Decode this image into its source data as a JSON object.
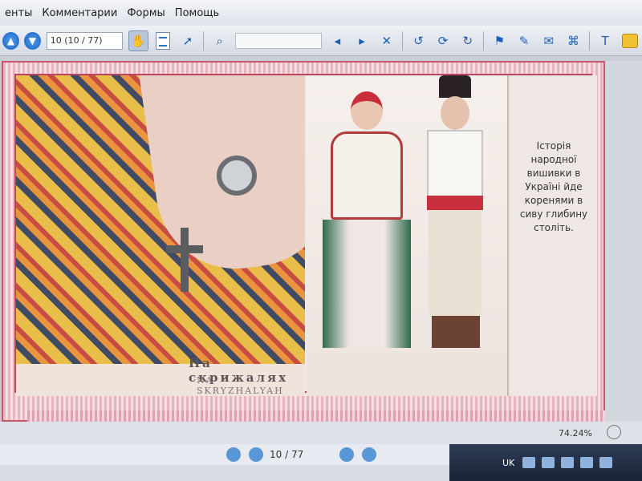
{
  "menubar": {
    "items": [
      "енты",
      "Комментарии",
      "Формы",
      "Помощь"
    ]
  },
  "toolbar": {
    "page_field": "10 (10 / 77)",
    "search_placeholder": ""
  },
  "slide": {
    "caption_title": "На скрижалях",
    "caption_sub": "NA-SKRYZHALYAH",
    "text": "Історія народної вишивки в Україні йде коренями в сиву глибину століть."
  },
  "status": {
    "zoom": "74.24%"
  },
  "navigation": {
    "page_indicator": "10 / 77"
  },
  "taskbar": {
    "language": "UK"
  },
  "colors": {
    "frame_border": "#c9566f",
    "accent_blue": "#1d5fb8"
  }
}
